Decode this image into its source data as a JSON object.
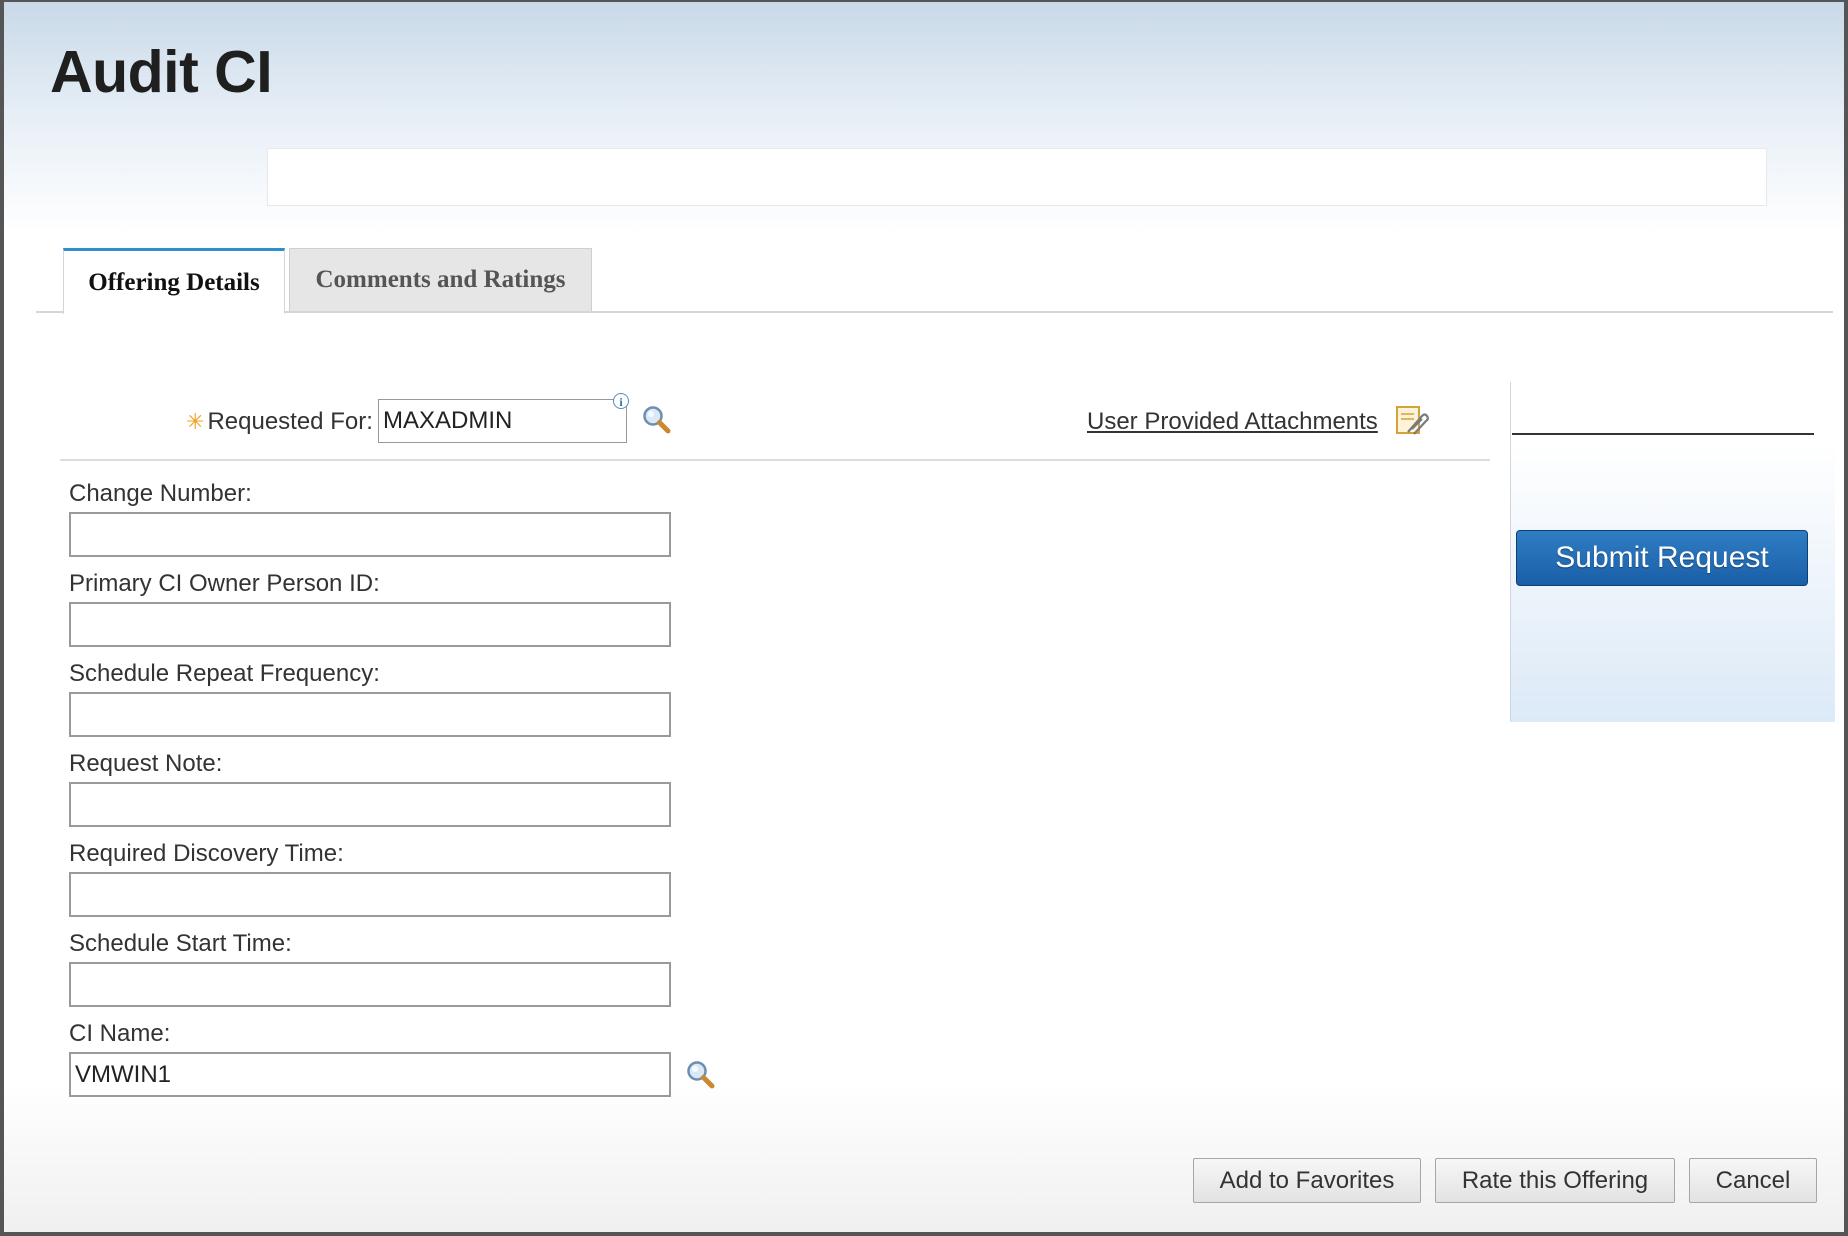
{
  "page": {
    "title": "Audit CI",
    "description": ""
  },
  "tabs": [
    {
      "label": "Offering Details",
      "active": true
    },
    {
      "label": "Comments and Ratings",
      "active": false
    }
  ],
  "requested_for": {
    "required_marker": "✳",
    "label": "Requested For:",
    "value": "MAXADMIN",
    "info_icon": "info-icon",
    "lookup_icon": "magnifier-icon"
  },
  "attachments": {
    "label": "User Provided Attachments",
    "icon": "attachment-edit-icon"
  },
  "fields": [
    {
      "label": "Change Number:",
      "value": ""
    },
    {
      "label": "Primary CI Owner Person ID:",
      "value": ""
    },
    {
      "label": "Schedule Repeat Frequency:",
      "value": ""
    },
    {
      "label": "Request Note:",
      "value": ""
    },
    {
      "label": "Required Discovery Time:",
      "value": ""
    },
    {
      "label": "Schedule Start Time:",
      "value": ""
    },
    {
      "label": "CI Name:",
      "value": "VMWIN1"
    }
  ],
  "side_panel": {
    "submit_label": "Submit Request"
  },
  "footer": {
    "favorites_label": "Add to Favorites",
    "rate_label": "Rate this Offering",
    "cancel_label": "Cancel"
  },
  "colors": {
    "accent_blue": "#1a5fa8",
    "tab_active_border": "#2e8fd0",
    "required_star": "#f0a020",
    "header_gradient_top": "#c9d9e8"
  }
}
